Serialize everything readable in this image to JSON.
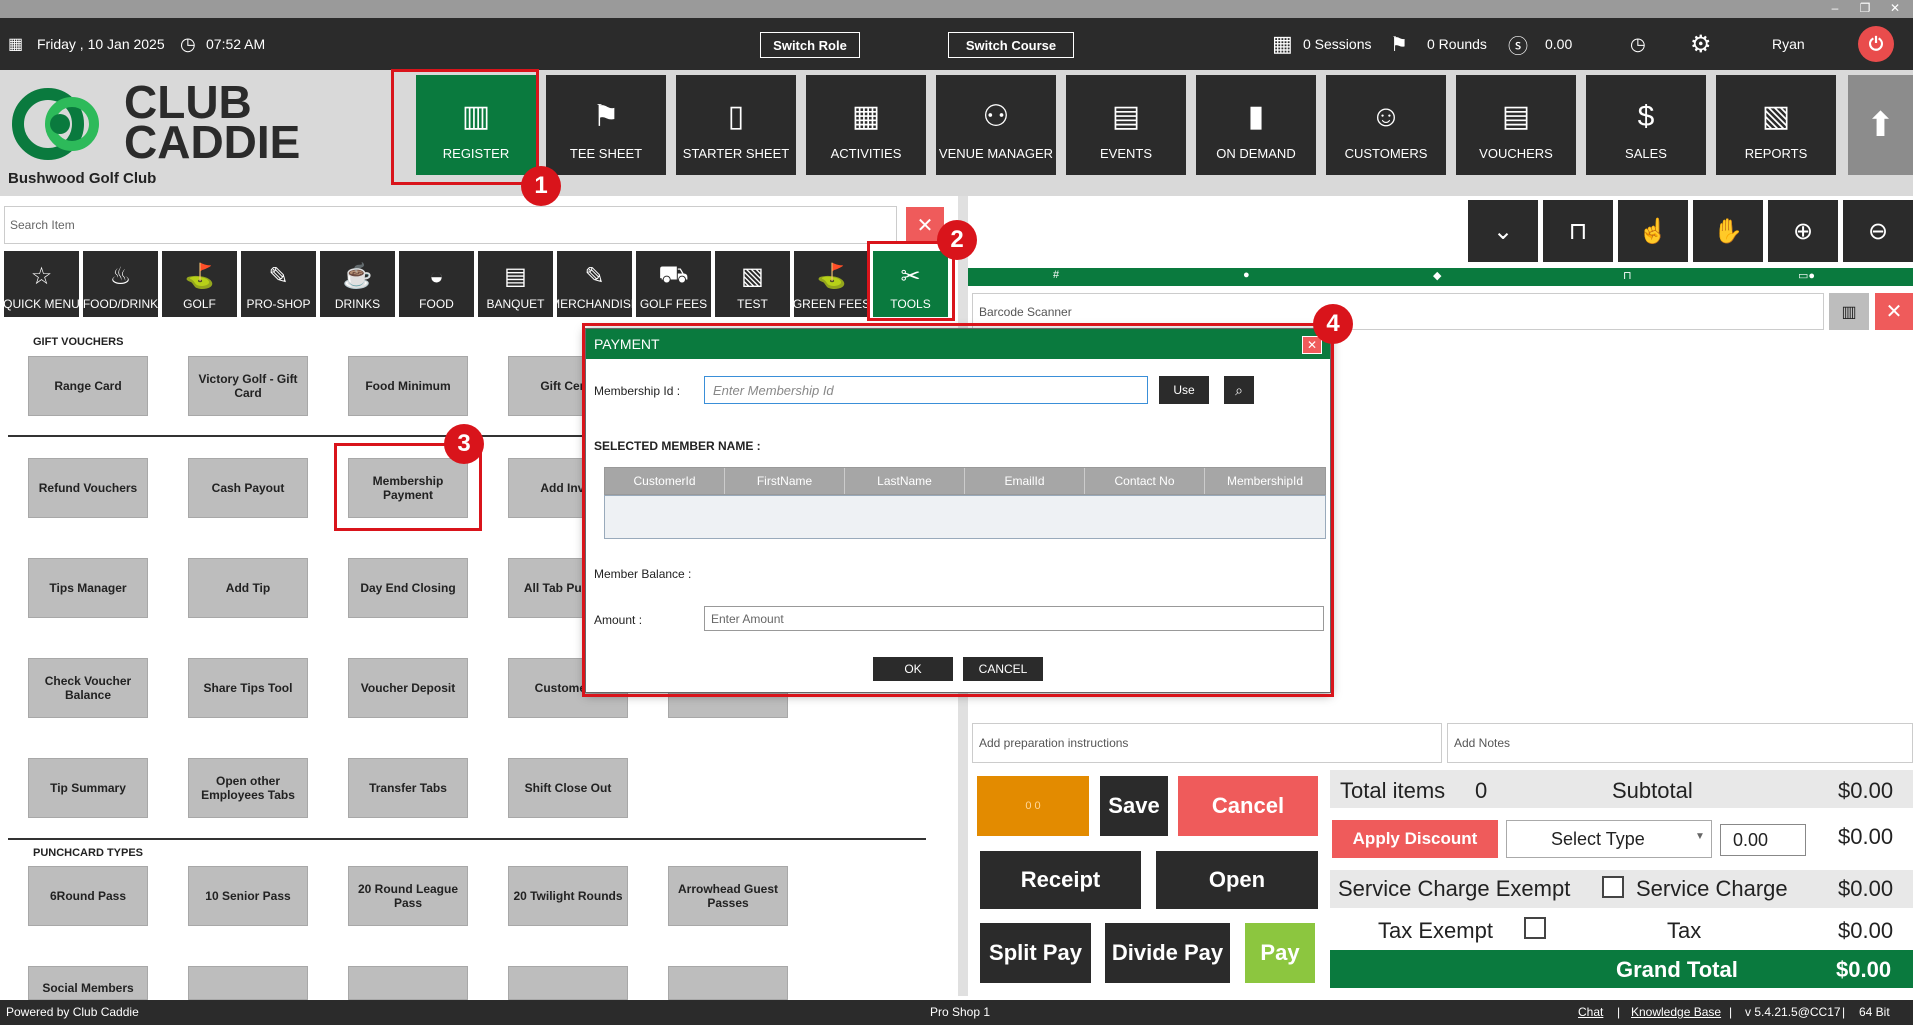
{
  "window": {
    "minimize": "–",
    "restore": "❐",
    "close": "✕"
  },
  "topbar": {
    "date": "Friday ,  10 Jan 2025",
    "time": "07:52 AM",
    "switch_role": "Switch Role",
    "switch_course": "Switch Course",
    "sessions": "0 Sessions",
    "rounds": "0 Rounds",
    "balance": "0.00",
    "user": "Ryan"
  },
  "logo": {
    "line1": "CLUB",
    "line2": "CADDIE",
    "club": "Bushwood Golf Club"
  },
  "modules": [
    {
      "label": "REGISTER",
      "icon": "barcode-scanner-icon",
      "glyph": "▥"
    },
    {
      "label": "TEE SHEET",
      "icon": "tee-sheet-icon",
      "glyph": "⚑"
    },
    {
      "label": "STARTER SHEET",
      "icon": "tablet-icon",
      "glyph": "▯"
    },
    {
      "label": "ACTIVITIES",
      "icon": "calendar-icon",
      "glyph": "▦"
    },
    {
      "label": "VENUE MANAGER",
      "icon": "meeting-icon",
      "glyph": "⚇"
    },
    {
      "label": "EVENTS",
      "icon": "events-calendar-icon",
      "glyph": "▤"
    },
    {
      "label": "ON DEMAND",
      "icon": "mobile-icon",
      "glyph": "▮"
    },
    {
      "label": "CUSTOMERS",
      "icon": "customers-icon",
      "glyph": "☺"
    },
    {
      "label": "VOUCHERS",
      "icon": "vouchers-icon",
      "glyph": "▤"
    },
    {
      "label": "SALES",
      "icon": "sales-icon",
      "glyph": "$"
    },
    {
      "label": "REPORTS",
      "icon": "reports-icon",
      "glyph": "▧"
    }
  ],
  "search": {
    "placeholder": "Search Item",
    "clear": "✕"
  },
  "categories": [
    {
      "label": "QUICK MENU",
      "glyph": "☆"
    },
    {
      "label": "FOOD/DRINK",
      "glyph": "♨"
    },
    {
      "label": "GOLF",
      "glyph": "⛳"
    },
    {
      "label": "PRO-SHOP",
      "glyph": "✎"
    },
    {
      "label": "DRINKS",
      "glyph": "☕"
    },
    {
      "label": "FOOD",
      "glyph": "◒"
    },
    {
      "label": "BANQUET",
      "glyph": "▤"
    },
    {
      "label": "MERCHANDISE",
      "glyph": "✎"
    },
    {
      "label": "GOLF FEES",
      "glyph": "⛟"
    },
    {
      "label": "TEST",
      "glyph": "▧"
    },
    {
      "label": "GREEN FEES",
      "glyph": "⛳"
    },
    {
      "label": "TOOLS",
      "glyph": "✂"
    }
  ],
  "sections": {
    "gift_vouchers": "GIFT VOUCHERS",
    "punchcard": "PUNCHCARD TYPES"
  },
  "tiles": {
    "row1": [
      "Range Card",
      "Victory Golf - Gift Card",
      "Food Minimum",
      "Gift Certif"
    ],
    "row2": [
      "Refund Vouchers",
      "Cash Payout",
      "Membership Payment",
      "Add Inver"
    ],
    "row3": [
      "Tips Manager",
      "Add Tip",
      "Day End Closing",
      "All Tab Pull Tab"
    ],
    "row4": [
      "Check Voucher Balance",
      "Share Tips Tool",
      "Voucher Deposit",
      "Customer L"
    ],
    "row5": [
      "Tip Summary",
      "Open other Employees Tabs",
      "Transfer Tabs",
      "Shift Close Out"
    ],
    "row6": [
      "6Round Pass",
      "10 Senior Pass",
      "20 Round League Pass",
      "20 Twilight Rounds",
      "Arrowhead Guest Passes"
    ],
    "row7": [
      "Social Members",
      "",
      "",
      "",
      ""
    ]
  },
  "order": {
    "barcode_placeholder": "Barcode Scanner",
    "prep_placeholder": "Add preparation instructions",
    "notes_placeholder": "Add Notes",
    "counter": "0   0",
    "save": "Save",
    "cancel": "Cancel",
    "receipt": "Receipt",
    "open": "Open",
    "split_pay": "Split Pay",
    "divide_pay": "Divide Pay",
    "pay": "Pay"
  },
  "totals": {
    "total_items_label": "Total items",
    "total_items": "0",
    "subtotal_label": "Subtotal",
    "subtotal": "$0.00",
    "apply_discount": "Apply Discount",
    "select_type": "Select Type",
    "discount_value": "0.00",
    "discount_amount": "$0.00",
    "service_exempt": "Service Charge Exempt",
    "service_charge_label": "Service Charge",
    "service_charge": "$0.00",
    "tax_exempt": "Tax Exempt",
    "tax_label": "Tax",
    "tax": "$0.00",
    "grand_total_label": "Grand Total",
    "grand_total": "$0.00"
  },
  "modal": {
    "title": "PAYMENT",
    "close": "✕",
    "membership_label": "Membership Id :",
    "membership_placeholder": "Enter Membership Id",
    "use": "Use",
    "selected_member": "SELECTED MEMBER NAME :",
    "columns": [
      "CustomerId",
      "FirstName",
      "LastName",
      "EmailId",
      "Contact No",
      "MembershipId"
    ],
    "member_balance": "Member Balance :",
    "amount_label": "Amount :",
    "amount_placeholder": "Enter Amount",
    "ok": "OK",
    "cancel": "CANCEL"
  },
  "footer": {
    "powered": "Powered by Club Caddie",
    "station": "Pro Shop 1",
    "chat": "Chat",
    "kb": "Knowledge Base",
    "version": "v 5.4.21.5@CC17",
    "bits": "64 Bit",
    "sep": "|"
  },
  "annotations": [
    "1",
    "2",
    "3",
    "4"
  ],
  "colors": {
    "brand_green": "#0a7a3e",
    "dark": "#2b2b2b",
    "red": "#ef5b5b",
    "highlight": "#d9141b"
  }
}
